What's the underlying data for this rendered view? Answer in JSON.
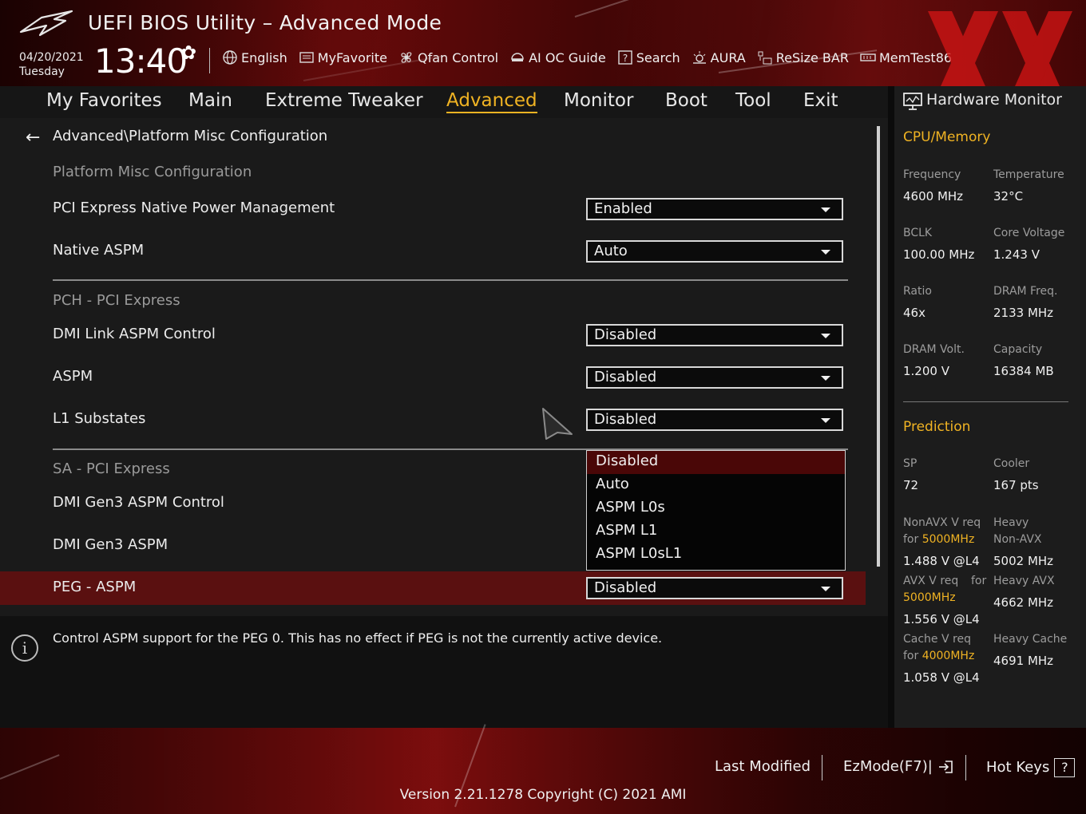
{
  "header": {
    "title": "UEFI BIOS Utility – Advanced Mode",
    "date": "04/20/2021",
    "day": "Tuesday",
    "time": "13:40",
    "toolbar": [
      {
        "label": "English",
        "icon": "globe-icon"
      },
      {
        "label": "MyFavorite",
        "icon": "favorite-icon"
      },
      {
        "label": "Qfan Control",
        "icon": "fan-icon"
      },
      {
        "label": "AI OC Guide",
        "icon": "ai-oc-icon"
      },
      {
        "label": "Search",
        "icon": "search-icon"
      },
      {
        "label": "AURA",
        "icon": "aura-icon"
      },
      {
        "label": "ReSize BAR",
        "icon": "resize-bar-icon"
      },
      {
        "label": "MemTest86",
        "icon": "memtest-icon"
      }
    ]
  },
  "menu": [
    "My Favorites",
    "Main",
    "Extreme Tweaker",
    "Advanced",
    "Monitor",
    "Boot",
    "Tool",
    "Exit"
  ],
  "active_menu": "Advanced",
  "content": {
    "breadcrumb": "Advanced\\Platform Misc Configuration",
    "section_platform": "Platform Misc Configuration",
    "section_pch": "PCH - PCI Express",
    "section_sa": "SA - PCI Express",
    "rows": {
      "pcie_native_pm": {
        "label": "PCI Express Native Power Management",
        "value": "Enabled"
      },
      "native_aspm": {
        "label": "Native ASPM",
        "value": "Auto"
      },
      "dmi_link_aspm": {
        "label": "DMI Link ASPM Control",
        "value": "Disabled"
      },
      "aspm": {
        "label": "ASPM",
        "value": "Disabled"
      },
      "l1_substates": {
        "label": "L1 Substates",
        "value": "Disabled"
      },
      "dmi_gen3_aspm_control": {
        "label": "DMI Gen3 ASPM Control"
      },
      "dmi_gen3_aspm": {
        "label": "DMI Gen3 ASPM"
      },
      "peg_aspm": {
        "label": "PEG - ASPM",
        "value": "Disabled"
      }
    },
    "dropdown_options": [
      "Disabled",
      "Auto",
      "ASPM L0s",
      "ASPM L1",
      "ASPM L0sL1"
    ],
    "dropdown_selected": "Disabled"
  },
  "help": {
    "text": "Control ASPM support for the PEG 0.  This has no effect if PEG is not the currently active device."
  },
  "hw_monitor": {
    "title": "Hardware Monitor",
    "cpu_memory": {
      "heading": "CPU/Memory",
      "frequency_label": "Frequency",
      "frequency": "4600 MHz",
      "temperature_label": "Temperature",
      "temperature": "32°C",
      "bclk_label": "BCLK",
      "bclk": "100.00 MHz",
      "core_voltage_label": "Core Voltage",
      "core_voltage": "1.243 V",
      "ratio_label": "Ratio",
      "ratio": "46x",
      "dram_freq_label": "DRAM Freq.",
      "dram_freq": "2133 MHz",
      "dram_volt_label": "DRAM Volt.",
      "dram_volt": "1.200 V",
      "capacity_label": "Capacity",
      "capacity": "16384 MB"
    },
    "prediction": {
      "heading": "Prediction",
      "sp_label": "SP",
      "sp": "72",
      "cooler_label": "Cooler",
      "cooler": "167 pts",
      "nonavx_label": "NonAVX V req",
      "nonavx_for": "for",
      "nonavx_freq": "5000MHz",
      "nonavx_v": "1.488 V @L4",
      "heavy_nonavx_label1": "Heavy",
      "heavy_nonavx_label2": "Non-AVX",
      "heavy_nonavx": "5002 MHz",
      "avx_label": "AVX V req",
      "avx_for": "for",
      "avx_freq": "5000MHz",
      "avx_v": "1.556 V @L4",
      "heavy_avx_label": "Heavy AVX",
      "heavy_avx": "4662 MHz",
      "cache_label": "Cache V req",
      "cache_for": "for",
      "cache_freq": "4000MHz",
      "cache_v": "1.058 V @L4",
      "heavy_cache_label": "Heavy Cache",
      "heavy_cache": "4691 MHz"
    }
  },
  "footer": {
    "last_modified": "Last Modified",
    "ezmode": "EzMode(F7)|",
    "hot_keys": "Hot Keys",
    "hot_keys_key": "?",
    "version": "Version 2.21.1278 Copyright (C) 2021 AMI"
  },
  "colors": {
    "accent": "#f0b323",
    "highlight_row": "#5a1010",
    "selected_option": "#4a0707"
  }
}
